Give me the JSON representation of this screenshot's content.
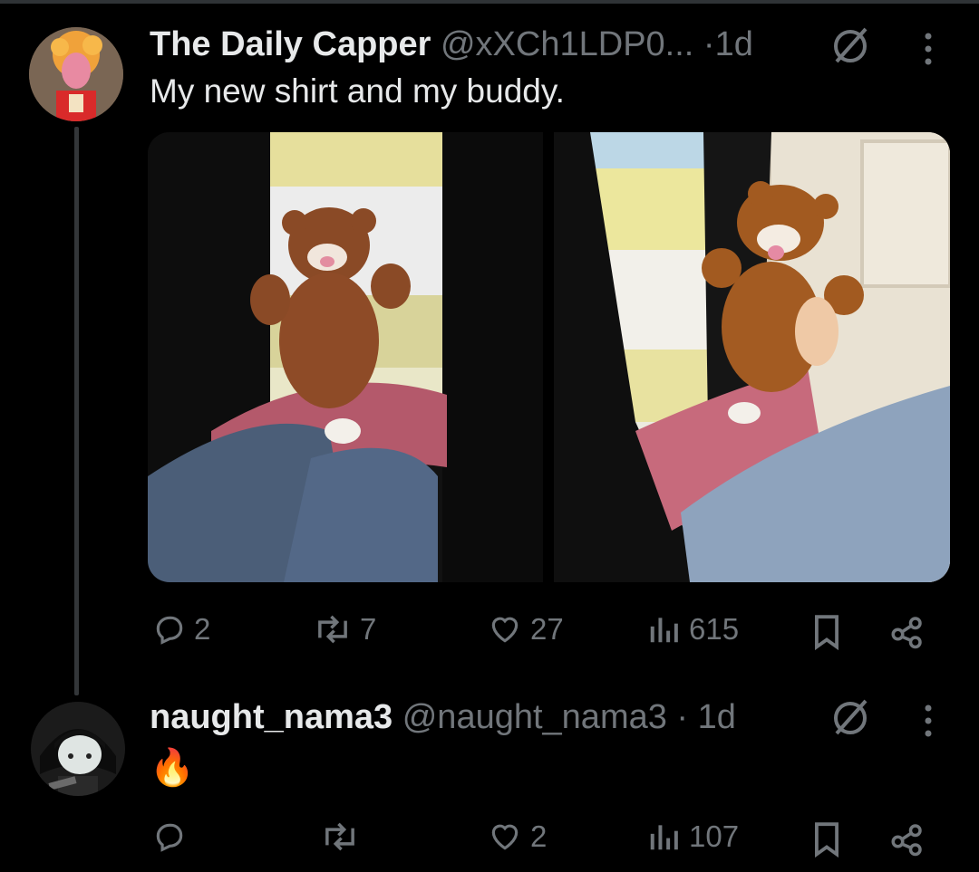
{
  "post": {
    "display_name": "The Daily Capper",
    "handle": "@xXCh1LDP0...",
    "separator": "·",
    "time": "1d",
    "text": "My new shirt and my buddy.",
    "actions": {
      "replies": "2",
      "reposts": "7",
      "likes": "27",
      "views": "615"
    }
  },
  "reply": {
    "display_name": "naught_nama3",
    "handle": "@naught_nama3",
    "separator": "·",
    "time": "1d",
    "text": "🔥",
    "actions": {
      "replies": "",
      "reposts": "",
      "likes": "2",
      "views": "107"
    }
  },
  "colors": {
    "background": "#000000",
    "text": "#e7e9ea",
    "muted": "#71767b",
    "divider": "#2f3336"
  },
  "icons": [
    "reply-icon",
    "repost-icon",
    "like-icon",
    "views-icon",
    "bookmark-icon",
    "share-icon",
    "grok-icon",
    "more-icon"
  ]
}
